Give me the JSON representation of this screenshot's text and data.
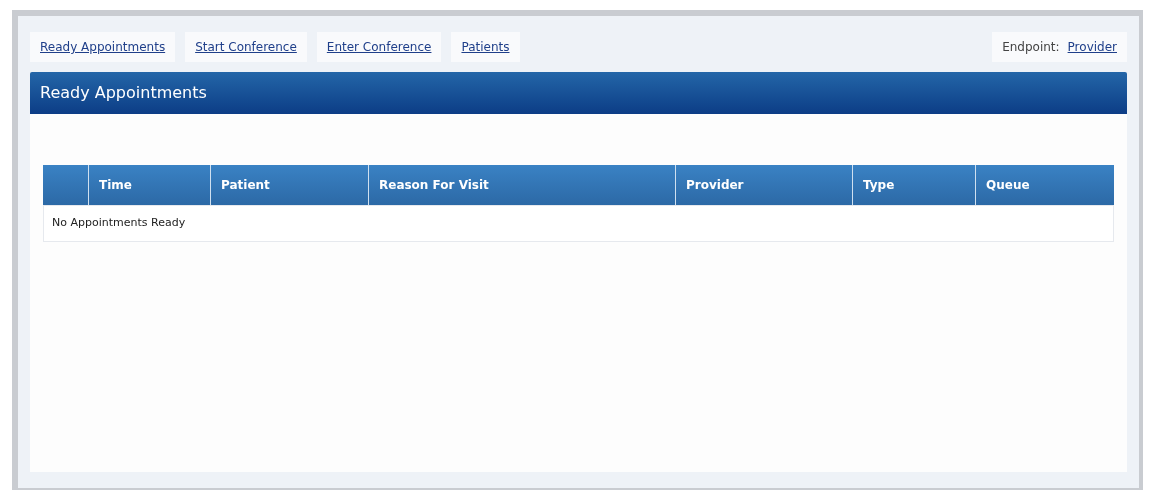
{
  "nav_links": [
    {
      "label": "Ready Appointments"
    },
    {
      "label": "Start Conference"
    },
    {
      "label": "Enter Conference"
    },
    {
      "label": "Patients"
    }
  ],
  "endpoint": {
    "label": "Endpoint:",
    "value": "Provider"
  },
  "panel": {
    "title": "Ready Appointments"
  },
  "table": {
    "columns": [
      "Time",
      "Patient",
      "Reason For Visit",
      "Provider",
      "Type",
      "Queue"
    ],
    "empty_message": "No Appointments Ready"
  }
}
